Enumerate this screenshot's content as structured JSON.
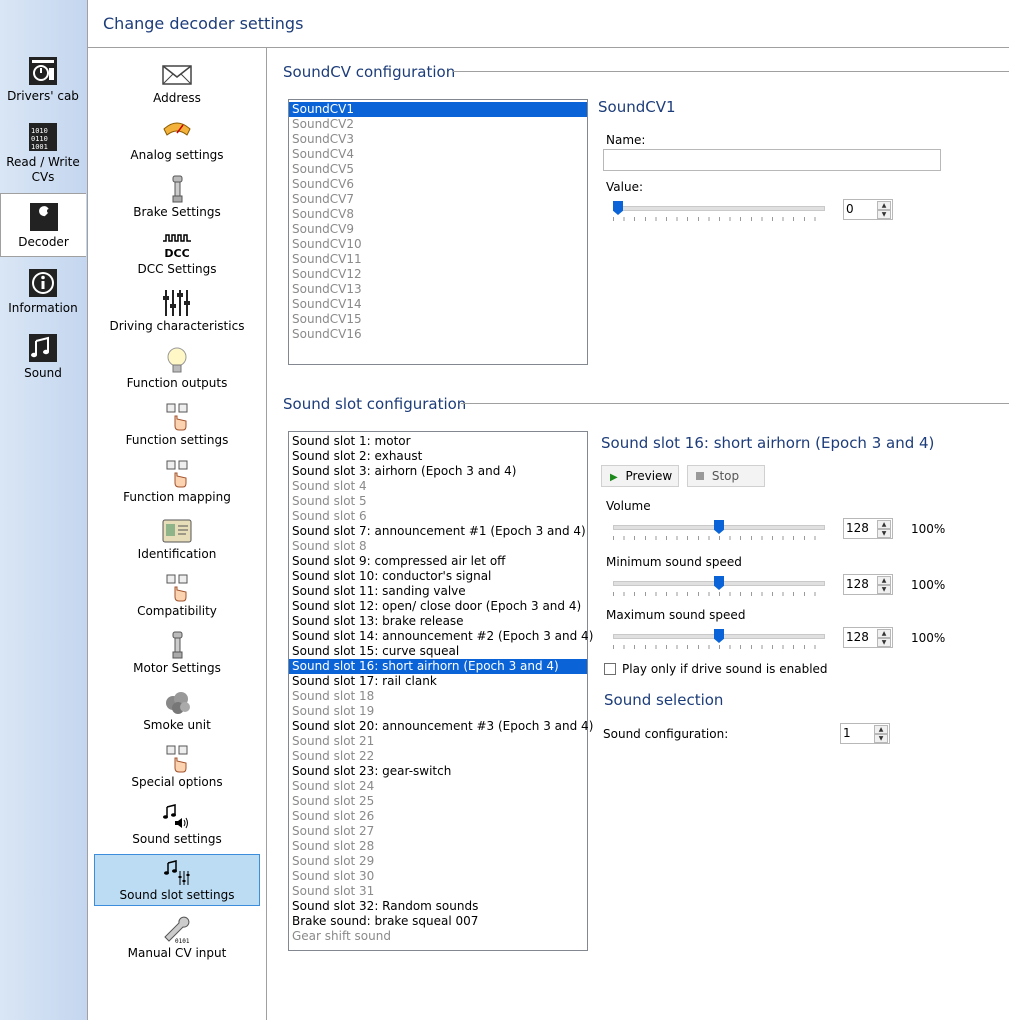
{
  "window_title": "Change decoder settings",
  "tabs": [
    {
      "label": "Drivers' cab",
      "icon": "drivers-cab-icon"
    },
    {
      "label": "Read / Write CVs",
      "icon": "read-write-cv-icon"
    },
    {
      "label": "Decoder",
      "icon": "wrench-icon",
      "active": true
    },
    {
      "label": "Information",
      "icon": "info-icon"
    },
    {
      "label": "Sound",
      "icon": "music-note-icon"
    }
  ],
  "categories": [
    {
      "label": "Address",
      "icon": "envelope-icon"
    },
    {
      "label": "Analog settings",
      "icon": "gauge-icon"
    },
    {
      "label": "Brake Settings",
      "icon": "brake-icon"
    },
    {
      "label": "DCC Settings",
      "icon": "dcc-icon"
    },
    {
      "label": "Driving characteristics",
      "icon": "sliders-icon"
    },
    {
      "label": "Function outputs",
      "icon": "lightbulb-icon"
    },
    {
      "label": "Function settings",
      "icon": "function-keys-icon"
    },
    {
      "label": "Function mapping",
      "icon": "function-keys-icon"
    },
    {
      "label": "Identification",
      "icon": "id-card-icon"
    },
    {
      "label": "Compatibility",
      "icon": "function-keys-icon"
    },
    {
      "label": "Motor Settings",
      "icon": "brake-icon"
    },
    {
      "label": "Smoke unit",
      "icon": "smoke-icon"
    },
    {
      "label": "Special options",
      "icon": "function-keys-icon"
    },
    {
      "label": "Sound settings",
      "icon": "sound-settings-icon"
    },
    {
      "label": "Sound slot settings",
      "icon": "sound-slot-icon",
      "selected": true
    },
    {
      "label": "Manual CV input",
      "icon": "manual-cv-icon"
    }
  ],
  "soundcv": {
    "section_title": "SoundCV configuration",
    "items": [
      "SoundCV1",
      "SoundCV2",
      "SoundCV3",
      "SoundCV4",
      "SoundCV5",
      "SoundCV6",
      "SoundCV7",
      "SoundCV8",
      "SoundCV9",
      "SoundCV10",
      "SoundCV11",
      "SoundCV12",
      "SoundCV13",
      "SoundCV14",
      "SoundCV15",
      "SoundCV16"
    ],
    "selected_index": 0,
    "detail_title": "SoundCV1",
    "name_label": "Name:",
    "name_value": "",
    "value_label": "Value:",
    "value": "0",
    "slider_fraction": 0
  },
  "soundslot": {
    "section_title": "Sound slot configuration",
    "items": [
      {
        "label": "Sound slot 1: motor",
        "dim": false
      },
      {
        "label": "Sound slot 2: exhaust",
        "dim": false
      },
      {
        "label": "Sound slot 3: airhorn (Epoch 3 and 4)",
        "dim": false
      },
      {
        "label": "Sound slot 4",
        "dim": true
      },
      {
        "label": "Sound slot 5",
        "dim": true
      },
      {
        "label": "Sound slot 6",
        "dim": true
      },
      {
        "label": "Sound slot 7: announcement #1 (Epoch 3 and 4)",
        "dim": false
      },
      {
        "label": "Sound slot 8",
        "dim": true
      },
      {
        "label": "Sound slot 9: compressed air let off",
        "dim": false
      },
      {
        "label": "Sound slot 10: conductor's signal",
        "dim": false
      },
      {
        "label": "Sound slot 11: sanding valve",
        "dim": false
      },
      {
        "label": "Sound slot 12: open/ close door (Epoch 3 and 4)",
        "dim": false
      },
      {
        "label": "Sound slot 13: brake release",
        "dim": false
      },
      {
        "label": "Sound slot 14: announcement #2 (Epoch 3 and 4)",
        "dim": false
      },
      {
        "label": "Sound slot 15: curve squeal",
        "dim": false
      },
      {
        "label": "Sound slot 16: short airhorn (Epoch 3 and 4)",
        "dim": false
      },
      {
        "label": "Sound slot 17: rail clank",
        "dim": false
      },
      {
        "label": "Sound slot 18",
        "dim": true
      },
      {
        "label": "Sound slot 19",
        "dim": true
      },
      {
        "label": "Sound slot 20: announcement #3 (Epoch 3 and 4)",
        "dim": false
      },
      {
        "label": "Sound slot 21",
        "dim": true
      },
      {
        "label": "Sound slot 22",
        "dim": true
      },
      {
        "label": "Sound slot 23: gear-switch",
        "dim": false
      },
      {
        "label": "Sound slot 24",
        "dim": true
      },
      {
        "label": "Sound slot 25",
        "dim": true
      },
      {
        "label": "Sound slot 26",
        "dim": true
      },
      {
        "label": "Sound slot 27",
        "dim": true
      },
      {
        "label": "Sound slot 28",
        "dim": true
      },
      {
        "label": "Sound slot 29",
        "dim": true
      },
      {
        "label": "Sound slot 30",
        "dim": true
      },
      {
        "label": "Sound slot 31",
        "dim": true
      },
      {
        "label": "Sound slot 32: Random sounds",
        "dim": false
      },
      {
        "label": "Brake sound: brake squeal 007",
        "dim": false
      },
      {
        "label": "Gear shift sound",
        "dim": true
      }
    ],
    "selected_index": 15,
    "detail_title": "Sound slot 16: short airhorn (Epoch 3 and 4)",
    "preview_label": "Preview",
    "stop_label": "Stop",
    "params": [
      {
        "label": "Volume",
        "value": "128",
        "percent": "100%",
        "fraction": 0.5
      },
      {
        "label": "Minimum sound speed",
        "value": "128",
        "percent": "100%",
        "fraction": 0.5
      },
      {
        "label": "Maximum sound speed",
        "value": "128",
        "percent": "100%",
        "fraction": 0.5
      }
    ],
    "checkbox_label": "Play only if drive sound is enabled",
    "checkbox_checked": false,
    "selection_title": "Sound selection",
    "config_label": "Sound configuration:",
    "config_value": "1"
  },
  "colors": {
    "accent": "#0a64d8",
    "heading": "#1d3d7a",
    "selected_bg": "#bcdcf4"
  }
}
